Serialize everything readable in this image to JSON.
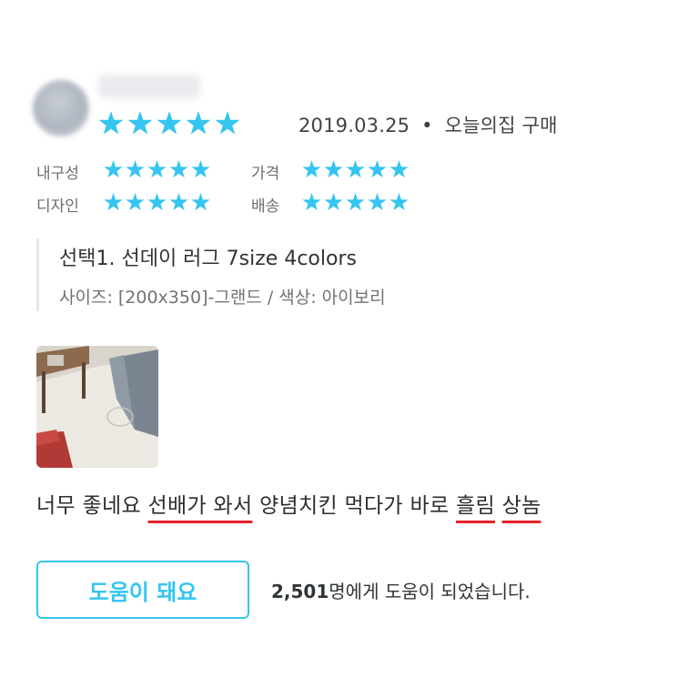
{
  "review": {
    "date": "2019.03.25",
    "separator": "•",
    "purchase_source": "오늘의집 구매",
    "rating": 5,
    "colors": {
      "star": "#35c5f0",
      "underline": "#e8232b",
      "accent": "#35c5f0"
    },
    "sub_ratings": [
      {
        "label": "내구성",
        "rating": 5
      },
      {
        "label": "가격",
        "rating": 5
      },
      {
        "label": "디자인",
        "rating": 5
      },
      {
        "label": "배송",
        "rating": 5
      }
    ],
    "option": {
      "title": "선택1. 선데이 러그 7size 4colors",
      "detail": "사이즈: [200x350]-그랜드 / 색상: 아이보리"
    },
    "text_segments": [
      {
        "text": "너무 좋네요 ",
        "underline": false
      },
      {
        "text": "선배가 와서",
        "underline": true
      },
      {
        "text": " 양념치킨 먹다가 바로 ",
        "underline": false
      },
      {
        "text": "흘림",
        "underline": true
      },
      {
        "text": " ",
        "underline": false
      },
      {
        "text": "상놈",
        "underline": true
      }
    ],
    "help": {
      "button_label": "도움이 돼요",
      "count": "2,501",
      "count_suffix": "명에게 도움이 되었습니다."
    }
  }
}
